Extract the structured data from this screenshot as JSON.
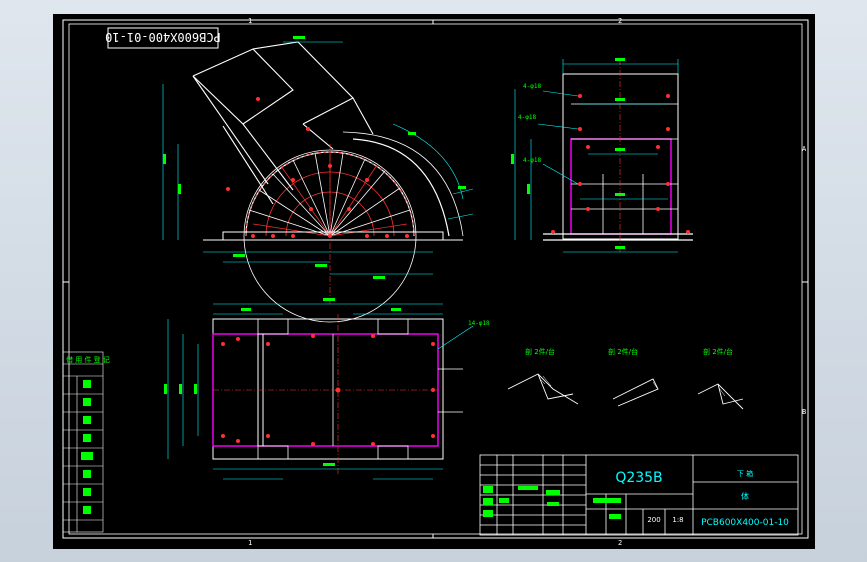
{
  "drawing": {
    "stamp_code": "PCB600X400-01-10",
    "grid": {
      "columns": [
        "1",
        "2"
      ],
      "rows": [
        "A",
        "B"
      ]
    },
    "sheet_bg": "#000000",
    "colors": {
      "border": "#ffffff",
      "frame": "#00e0e0",
      "dimension": "#00ffff",
      "hidden": "#ff3030",
      "part": "#ff00ff",
      "text_green": "#00ff00",
      "title_cyan": "#00ffff"
    }
  },
  "annotations": {
    "hole_top": "4-φ18",
    "hole_mid": "4-φ18",
    "hole_low": "4-φ18",
    "hole_plan": "14-φ18",
    "section_1": "剖 2件/台",
    "section_2": "剖 2件/台",
    "section_3": "剖 2件/台"
  },
  "title_block": {
    "material": "Q235B",
    "part_name": "下 箱",
    "part_sub": "体",
    "drawing_no": "PCB600X400-01-10",
    "scale_value": "200",
    "scale_ratio": "1:8"
  },
  "side_table": {
    "header": "借 用 件 登 记"
  }
}
